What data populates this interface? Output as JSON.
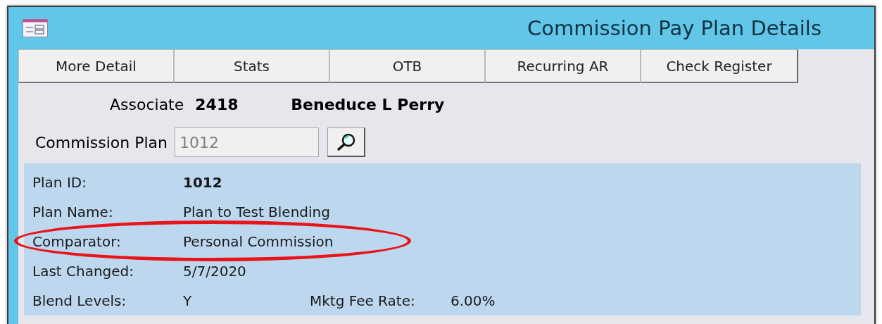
{
  "window": {
    "title": "Commission Pay Plan Details"
  },
  "buttons": [
    "More Detail",
    "Stats",
    "OTB",
    "Recurring AR",
    "Check Register"
  ],
  "associate": {
    "label": "Associate",
    "number": "2418",
    "name": "Beneduce L Perry"
  },
  "commission_plan": {
    "label": "Commission Plan",
    "value": "1012",
    "disabled": true
  },
  "details": [
    {
      "label": "Plan ID:",
      "value": "1012",
      "bold": true,
      "highlighted": false
    },
    {
      "label": "Plan Name:",
      "value": "Plan to Test Blending",
      "bold": false,
      "highlighted": false
    },
    {
      "label": "Comparator:",
      "value": "Personal Commission",
      "bold": false,
      "highlighted": true
    },
    {
      "label": "Last Changed:",
      "value": "5/7/2020",
      "bold": false,
      "highlighted": false
    },
    {
      "label": "Blend Levels:",
      "value": "Y",
      "bold": false,
      "highlighted": false,
      "extra": {
        "label": "Mktg Fee Rate:",
        "value": "6.00%"
      }
    }
  ]
}
